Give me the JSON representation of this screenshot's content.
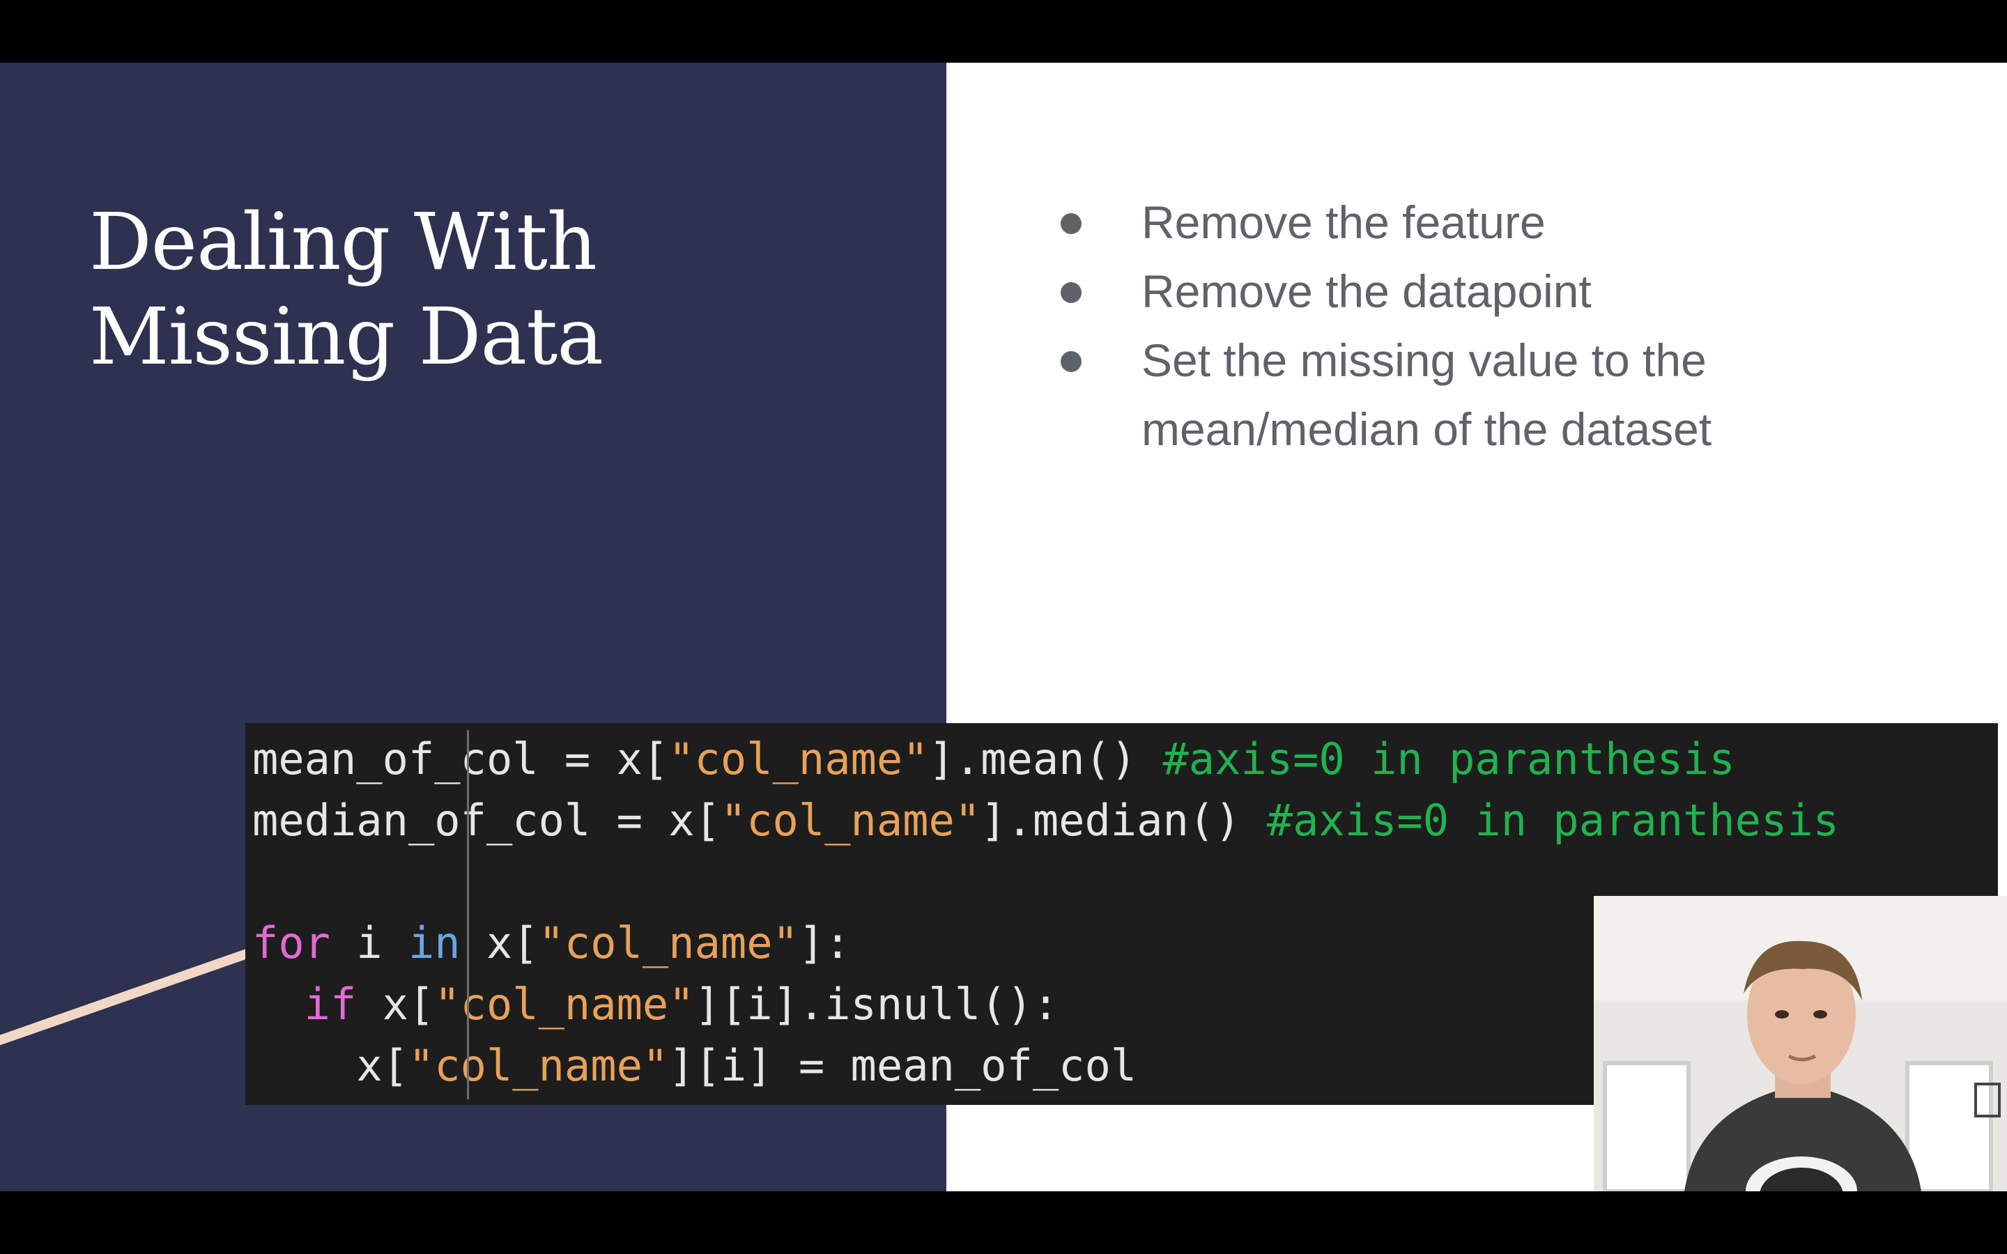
{
  "slide": {
    "title_lines": [
      "Dealing With",
      "Missing Data"
    ],
    "bullets": [
      "Remove the feature",
      "Remove the datapoint",
      "Set the missing value to the mean/median of the dataset"
    ]
  },
  "code": {
    "line1": {
      "a": "mean_of_col = x[",
      "s": "\"col_name\"",
      "b": "].mean() ",
      "c": "#axis=0 in paranthesis"
    },
    "line2": {
      "a": "median_of_col = x[",
      "s": "\"col_name\"",
      "b": "].median() ",
      "c": "#axis=0 in paranthesis"
    },
    "line4": {
      "kw": "for",
      "a": " i ",
      "kw2": "in",
      "b": " x[",
      "s": "\"col_name\"",
      "c": "]:"
    },
    "line5": {
      "indent": "  ",
      "kw": "if",
      "a": " x[",
      "s": "\"col_name\"",
      "b": "][i].isnull():"
    },
    "line6": {
      "indent": "    ",
      "a": "x[",
      "s": "\"col_name\"",
      "b": "][i] = mean_of_col"
    }
  },
  "colors": {
    "left_panel": "#2e3150",
    "code_background": "#1d1d1d",
    "keyword": "#e36ad3",
    "keyword_in": "#6aa6e6",
    "string": "#e8a15a",
    "comment": "#21b24f"
  },
  "icons": {
    "decorative_line": "diagonal-accent-line",
    "webcam": "presenter-webcam-overlay"
  }
}
